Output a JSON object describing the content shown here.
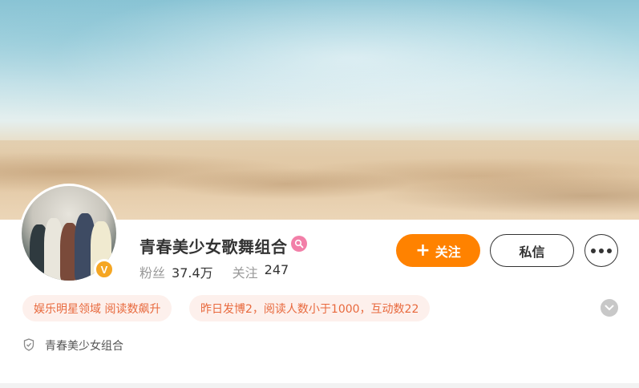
{
  "profile": {
    "name": "青春美少女歌舞组合",
    "verified_mark": "V",
    "stats": {
      "followers_label": "粉丝",
      "followers_value": "37.4万",
      "following_label": "关注",
      "following_value": "247"
    }
  },
  "actions": {
    "follow_label": "关注",
    "follow_icon": "plus-icon",
    "message_label": "私信",
    "more_icon": "more-dots-icon"
  },
  "tags": [
    {
      "text": "娱乐明星领域 阅读数飙升"
    },
    {
      "text": "昨日发博2，阅读人数小于1000，互动数22"
    }
  ],
  "description": {
    "icon": "shield-icon",
    "text": "青春美少女组合"
  },
  "colors": {
    "accent": "#ff8200",
    "tag_bg": "#fdf0ec",
    "tag_text": "#e8693d",
    "verified": "#f5a623",
    "search_badge": "#f27fa8"
  }
}
